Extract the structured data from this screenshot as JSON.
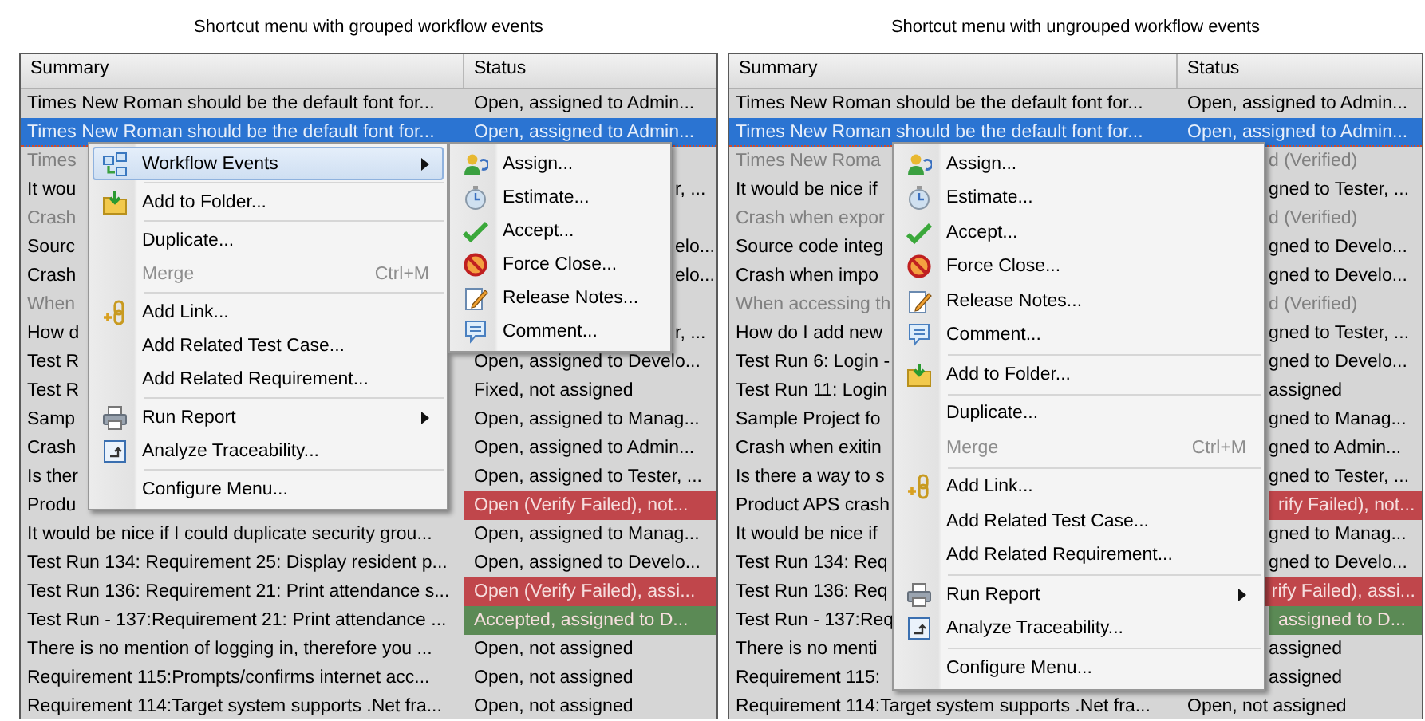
{
  "panels": [
    {
      "caption": "Shortcut menu with grouped workflow events",
      "columns": [
        "Summary",
        "Status"
      ],
      "rows": [
        {
          "summary": "Times New Roman should be the default font for...",
          "status": "Open, assigned to Admin...",
          "selected": false,
          "muted": false
        },
        {
          "summary": "Times New Roman should be the default font for...",
          "status": "Open, assigned to Admin...",
          "selected": true,
          "muted": false
        },
        {
          "summary": "Times",
          "selected": false,
          "muted": true
        },
        {
          "summary": "It wou",
          "status": "r, ...",
          "partly_hidden": true,
          "selected": false,
          "muted": false
        },
        {
          "summary": "Crash",
          "selected": false,
          "muted": true
        },
        {
          "summary": "Sourc",
          "status": "elo...",
          "partly_hidden": true,
          "selected": false,
          "muted": false
        },
        {
          "summary": "Crash",
          "status": "elo...",
          "partly_hidden": true,
          "selected": false,
          "muted": false
        },
        {
          "summary": "When",
          "selected": false,
          "muted": true
        },
        {
          "summary": "How d",
          "status": "r, ...",
          "partly_hidden": true,
          "selected": false,
          "muted": false
        },
        {
          "summary": "Test R",
          "status": "Open, assigned to Develo...",
          "selected": false,
          "muted": false
        },
        {
          "summary": "Test R",
          "status": "Fixed, not assigned",
          "selected": false,
          "muted": false
        },
        {
          "summary": "Samp",
          "status": "Open, assigned to Manag...",
          "selected": false,
          "muted": false
        },
        {
          "summary": "Crash",
          "status": "Open, assigned to Admin...",
          "selected": false,
          "muted": false
        },
        {
          "summary": "Is ther",
          "status": "Open, assigned to Tester, ...",
          "selected": false,
          "muted": false
        },
        {
          "summary": "Produ",
          "status": "Open (Verify Failed), not...",
          "color": "#c0464b",
          "selected": false,
          "muted": false
        },
        {
          "summary": "It would be nice if I could duplicate security grou...",
          "status": "Open, assigned to Manag...",
          "selected": false,
          "muted": false
        },
        {
          "summary": "Test Run 134: Requirement 25: Display resident p...",
          "status": "Open, assigned to Develo...",
          "selected": false,
          "muted": false
        },
        {
          "summary": "Test Run 136: Requirement 21: Print attendance s...",
          "status": "Open (Verify Failed), assi...",
          "color": "#c0464b",
          "selected": false,
          "muted": false
        },
        {
          "summary": "Test Run - 137:Requirement 21: Print attendance ...",
          "status": "Accepted, assigned to D...",
          "color": "#5b8a55",
          "selected": false,
          "muted": false
        },
        {
          "summary": "There is no mention of logging in, therefore you ...",
          "status": "Open, not assigned",
          "selected": false,
          "muted": false
        },
        {
          "summary": "Requirement 115:Prompts/confirms internet acc...",
          "status": "Open, not assigned",
          "selected": false,
          "muted": false
        },
        {
          "summary": "Requirement 114:Target system supports .Net fra...",
          "status": "Open, not assigned",
          "selected": false,
          "muted": false
        }
      ],
      "menu": [
        {
          "kind": "item",
          "label": "Workflow Events",
          "selected": true,
          "disabled": false,
          "submenu": true
        },
        {
          "kind": "separator"
        },
        {
          "kind": "item",
          "label": "Add to Folder...",
          "selected": false,
          "disabled": false,
          "submenu": false
        },
        {
          "kind": "separator"
        },
        {
          "kind": "item",
          "label": "Duplicate...",
          "selected": false,
          "disabled": false,
          "submenu": false
        },
        {
          "kind": "item",
          "label": "Merge",
          "shortcut": "Ctrl+M",
          "selected": false,
          "disabled": true,
          "submenu": false
        },
        {
          "kind": "separator"
        },
        {
          "kind": "item",
          "label": "Add Link...",
          "selected": false,
          "disabled": false,
          "submenu": false
        },
        {
          "kind": "item",
          "label": "Add Related Test Case...",
          "selected": false,
          "disabled": false,
          "submenu": false
        },
        {
          "kind": "item",
          "label": "Add Related Requirement...",
          "selected": false,
          "disabled": false,
          "submenu": false
        },
        {
          "kind": "separator"
        },
        {
          "kind": "item",
          "label": "Run Report",
          "selected": false,
          "disabled": false,
          "submenu": true
        },
        {
          "kind": "item",
          "label": "Analyze Traceability...",
          "selected": false,
          "disabled": false,
          "submenu": false
        },
        {
          "kind": "separator"
        },
        {
          "kind": "item",
          "label": "Configure Menu...",
          "selected": false,
          "disabled": false,
          "submenu": false
        }
      ],
      "submenu": [
        {
          "kind": "item",
          "label": "Assign...",
          "selected": false,
          "disabled": false,
          "submenu": false
        },
        {
          "kind": "item",
          "label": "Estimate...",
          "selected": false,
          "disabled": false,
          "submenu": false
        },
        {
          "kind": "item",
          "label": "Accept...",
          "selected": false,
          "disabled": false,
          "submenu": false
        },
        {
          "kind": "item",
          "label": "Force Close...",
          "selected": false,
          "disabled": false,
          "submenu": false
        },
        {
          "kind": "item",
          "label": "Release Notes...",
          "selected": false,
          "disabled": false,
          "submenu": false
        },
        {
          "kind": "item",
          "label": "Comment...",
          "selected": false,
          "disabled": false,
          "submenu": false
        }
      ]
    },
    {
      "caption": "Shortcut menu with ungrouped workflow events",
      "columns": [
        "Summary",
        "Status"
      ],
      "rows": [
        {
          "summary": "Times New Roman should be the default font for...",
          "status": "Open, assigned to Admin...",
          "selected": false,
          "muted": false
        },
        {
          "summary": "Times New Roman should be the default font for...",
          "status": "Open, assigned to Admin...",
          "selected": true,
          "muted": false
        },
        {
          "summary": "Times New Roma",
          "status": "d (Verified)",
          "partly_hidden": true,
          "selected": false,
          "muted": true
        },
        {
          "summary": "It would be nice if",
          "status": "gned to Tester, ...",
          "partly_hidden": true,
          "selected": false,
          "muted": false
        },
        {
          "summary": "Crash when expor",
          "status": "d (Verified)",
          "partly_hidden": true,
          "selected": false,
          "muted": true
        },
        {
          "summary": "Source code integ",
          "status": "gned to Develo...",
          "partly_hidden": true,
          "selected": false,
          "muted": false
        },
        {
          "summary": "Crash when impo",
          "status": "gned to Develo...",
          "partly_hidden": true,
          "selected": false,
          "muted": false
        },
        {
          "summary": "When accessing th",
          "status": "d (Verified)",
          "partly_hidden": true,
          "selected": false,
          "muted": true
        },
        {
          "summary": "How do I add new",
          "status": "gned to Tester, ...",
          "partly_hidden": true,
          "selected": false,
          "muted": false
        },
        {
          "summary": "Test Run 6: Login -",
          "status": "gned to Develo...",
          "partly_hidden": true,
          "selected": false,
          "muted": false
        },
        {
          "summary": "Test Run 11: Login",
          "status": "assigned",
          "partly_hidden": true,
          "selected": false,
          "muted": false
        },
        {
          "summary": "Sample Project fo",
          "status": "gned to Manag...",
          "partly_hidden": true,
          "selected": false,
          "muted": false
        },
        {
          "summary": "Crash when exitin",
          "status": "gned to Admin...",
          "partly_hidden": true,
          "selected": false,
          "muted": false
        },
        {
          "summary": "Is there a way to s",
          "status": "gned to Tester, ...",
          "partly_hidden": true,
          "selected": false,
          "muted": false
        },
        {
          "summary": "Product APS crash",
          "status": "rify Failed), not...",
          "partly_hidden": true,
          "color": "#c0464b",
          "selected": false,
          "muted": false
        },
        {
          "summary": "It would be nice if",
          "status": "gned to Manag...",
          "partly_hidden": true,
          "selected": false,
          "muted": false
        },
        {
          "summary": "Test Run 134: Req",
          "status": "gned to Develo...",
          "partly_hidden": true,
          "selected": false,
          "muted": false
        },
        {
          "summary": "Test Run 136: Req",
          "status": "rify Failed), assi...",
          "partly_hidden": true,
          "color": "#c0464b",
          "selected": false,
          "muted": false
        },
        {
          "summary": "Test Run - 137:Req",
          "status": "assigned to D...",
          "partly_hidden": true,
          "color": "#5b8a55",
          "selected": false,
          "muted": false
        },
        {
          "summary": "There is no menti",
          "status": "assigned",
          "partly_hidden": true,
          "selected": false,
          "muted": false
        },
        {
          "summary": "Requirement 115:",
          "status": "assigned",
          "partly_hidden": true,
          "selected": false,
          "muted": false
        },
        {
          "summary": "Requirement 114:Target system supports .Net fra...",
          "status": "Open, not assigned",
          "selected": false,
          "muted": false
        }
      ],
      "menu": [
        {
          "kind": "item",
          "label": "Assign...",
          "selected": false,
          "disabled": false,
          "submenu": false
        },
        {
          "kind": "item",
          "label": "Estimate...",
          "selected": false,
          "disabled": false,
          "submenu": false
        },
        {
          "kind": "item",
          "label": "Accept...",
          "selected": false,
          "disabled": false,
          "submenu": false
        },
        {
          "kind": "item",
          "label": "Force Close...",
          "selected": false,
          "disabled": false,
          "submenu": false
        },
        {
          "kind": "item",
          "label": "Release Notes...",
          "selected": false,
          "disabled": false,
          "submenu": false
        },
        {
          "kind": "item",
          "label": "Comment...",
          "selected": false,
          "disabled": false,
          "submenu": false
        },
        {
          "kind": "separator"
        },
        {
          "kind": "item",
          "label": "Add to Folder...",
          "selected": false,
          "disabled": false,
          "submenu": false
        },
        {
          "kind": "separator"
        },
        {
          "kind": "item",
          "label": "Duplicate...",
          "selected": false,
          "disabled": false,
          "submenu": false
        },
        {
          "kind": "item",
          "label": "Merge",
          "shortcut": "Ctrl+M",
          "selected": false,
          "disabled": true,
          "submenu": false
        },
        {
          "kind": "separator"
        },
        {
          "kind": "item",
          "label": "Add Link...",
          "selected": false,
          "disabled": false,
          "submenu": false
        },
        {
          "kind": "item",
          "label": "Add Related Test Case...",
          "selected": false,
          "disabled": false,
          "submenu": false
        },
        {
          "kind": "item",
          "label": "Add Related Requirement...",
          "selected": false,
          "disabled": false,
          "submenu": false
        },
        {
          "kind": "separator"
        },
        {
          "kind": "item",
          "label": "Run Report",
          "selected": false,
          "disabled": false,
          "submenu": true
        },
        {
          "kind": "item",
          "label": "Analyze Traceability...",
          "selected": false,
          "disabled": false,
          "submenu": false
        },
        {
          "kind": "separator"
        },
        {
          "kind": "item",
          "label": "Configure Menu...",
          "selected": false,
          "disabled": false,
          "submenu": false
        }
      ]
    }
  ]
}
